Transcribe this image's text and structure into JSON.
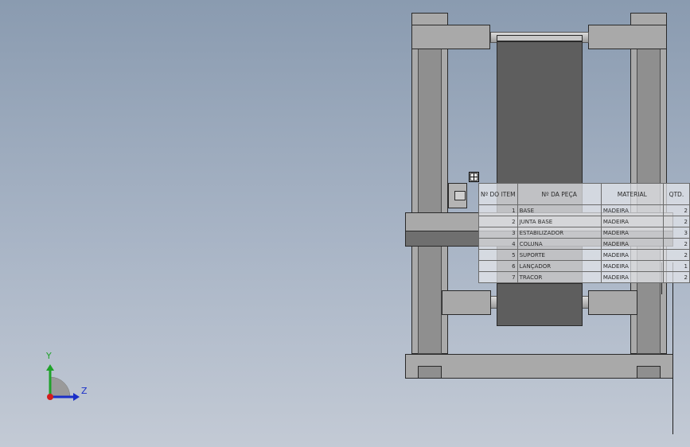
{
  "bom": {
    "headers": [
      "Nº DO ITEM",
      "Nº DA PEÇA",
      "MATERIAL",
      "QTD."
    ],
    "rows": [
      {
        "item": "1",
        "part": "BASE",
        "material": "MADEIRA",
        "qty": "2"
      },
      {
        "item": "2",
        "part": "JUNTA BASE",
        "material": "MADEIRA",
        "qty": "2"
      },
      {
        "item": "3",
        "part": "ESTABILIZADOR",
        "material": "MADEIRA",
        "qty": "3"
      },
      {
        "item": "4",
        "part": "COLUNA",
        "material": "MADEIRA",
        "qty": "2"
      },
      {
        "item": "5",
        "part": "SUPORTE",
        "material": "MADEIRA",
        "qty": "2"
      },
      {
        "item": "6",
        "part": "LANÇADOR",
        "material": "MADEIRA",
        "qty": "1"
      },
      {
        "item": "7",
        "part": "TRACOR",
        "material": "MADEIRA",
        "qty": "2"
      }
    ]
  },
  "triad": {
    "y_label": "Y",
    "z_label": "Z",
    "y_color": "#1fa22a",
    "z_color": "#1a2fc8",
    "x_color": "#d41c1c"
  },
  "colors": {
    "bg_top": "#8a9bb0",
    "bg_bottom": "#c3cad5",
    "part_light": "#a9a9a9",
    "part_dark": "#5e5e5e"
  }
}
